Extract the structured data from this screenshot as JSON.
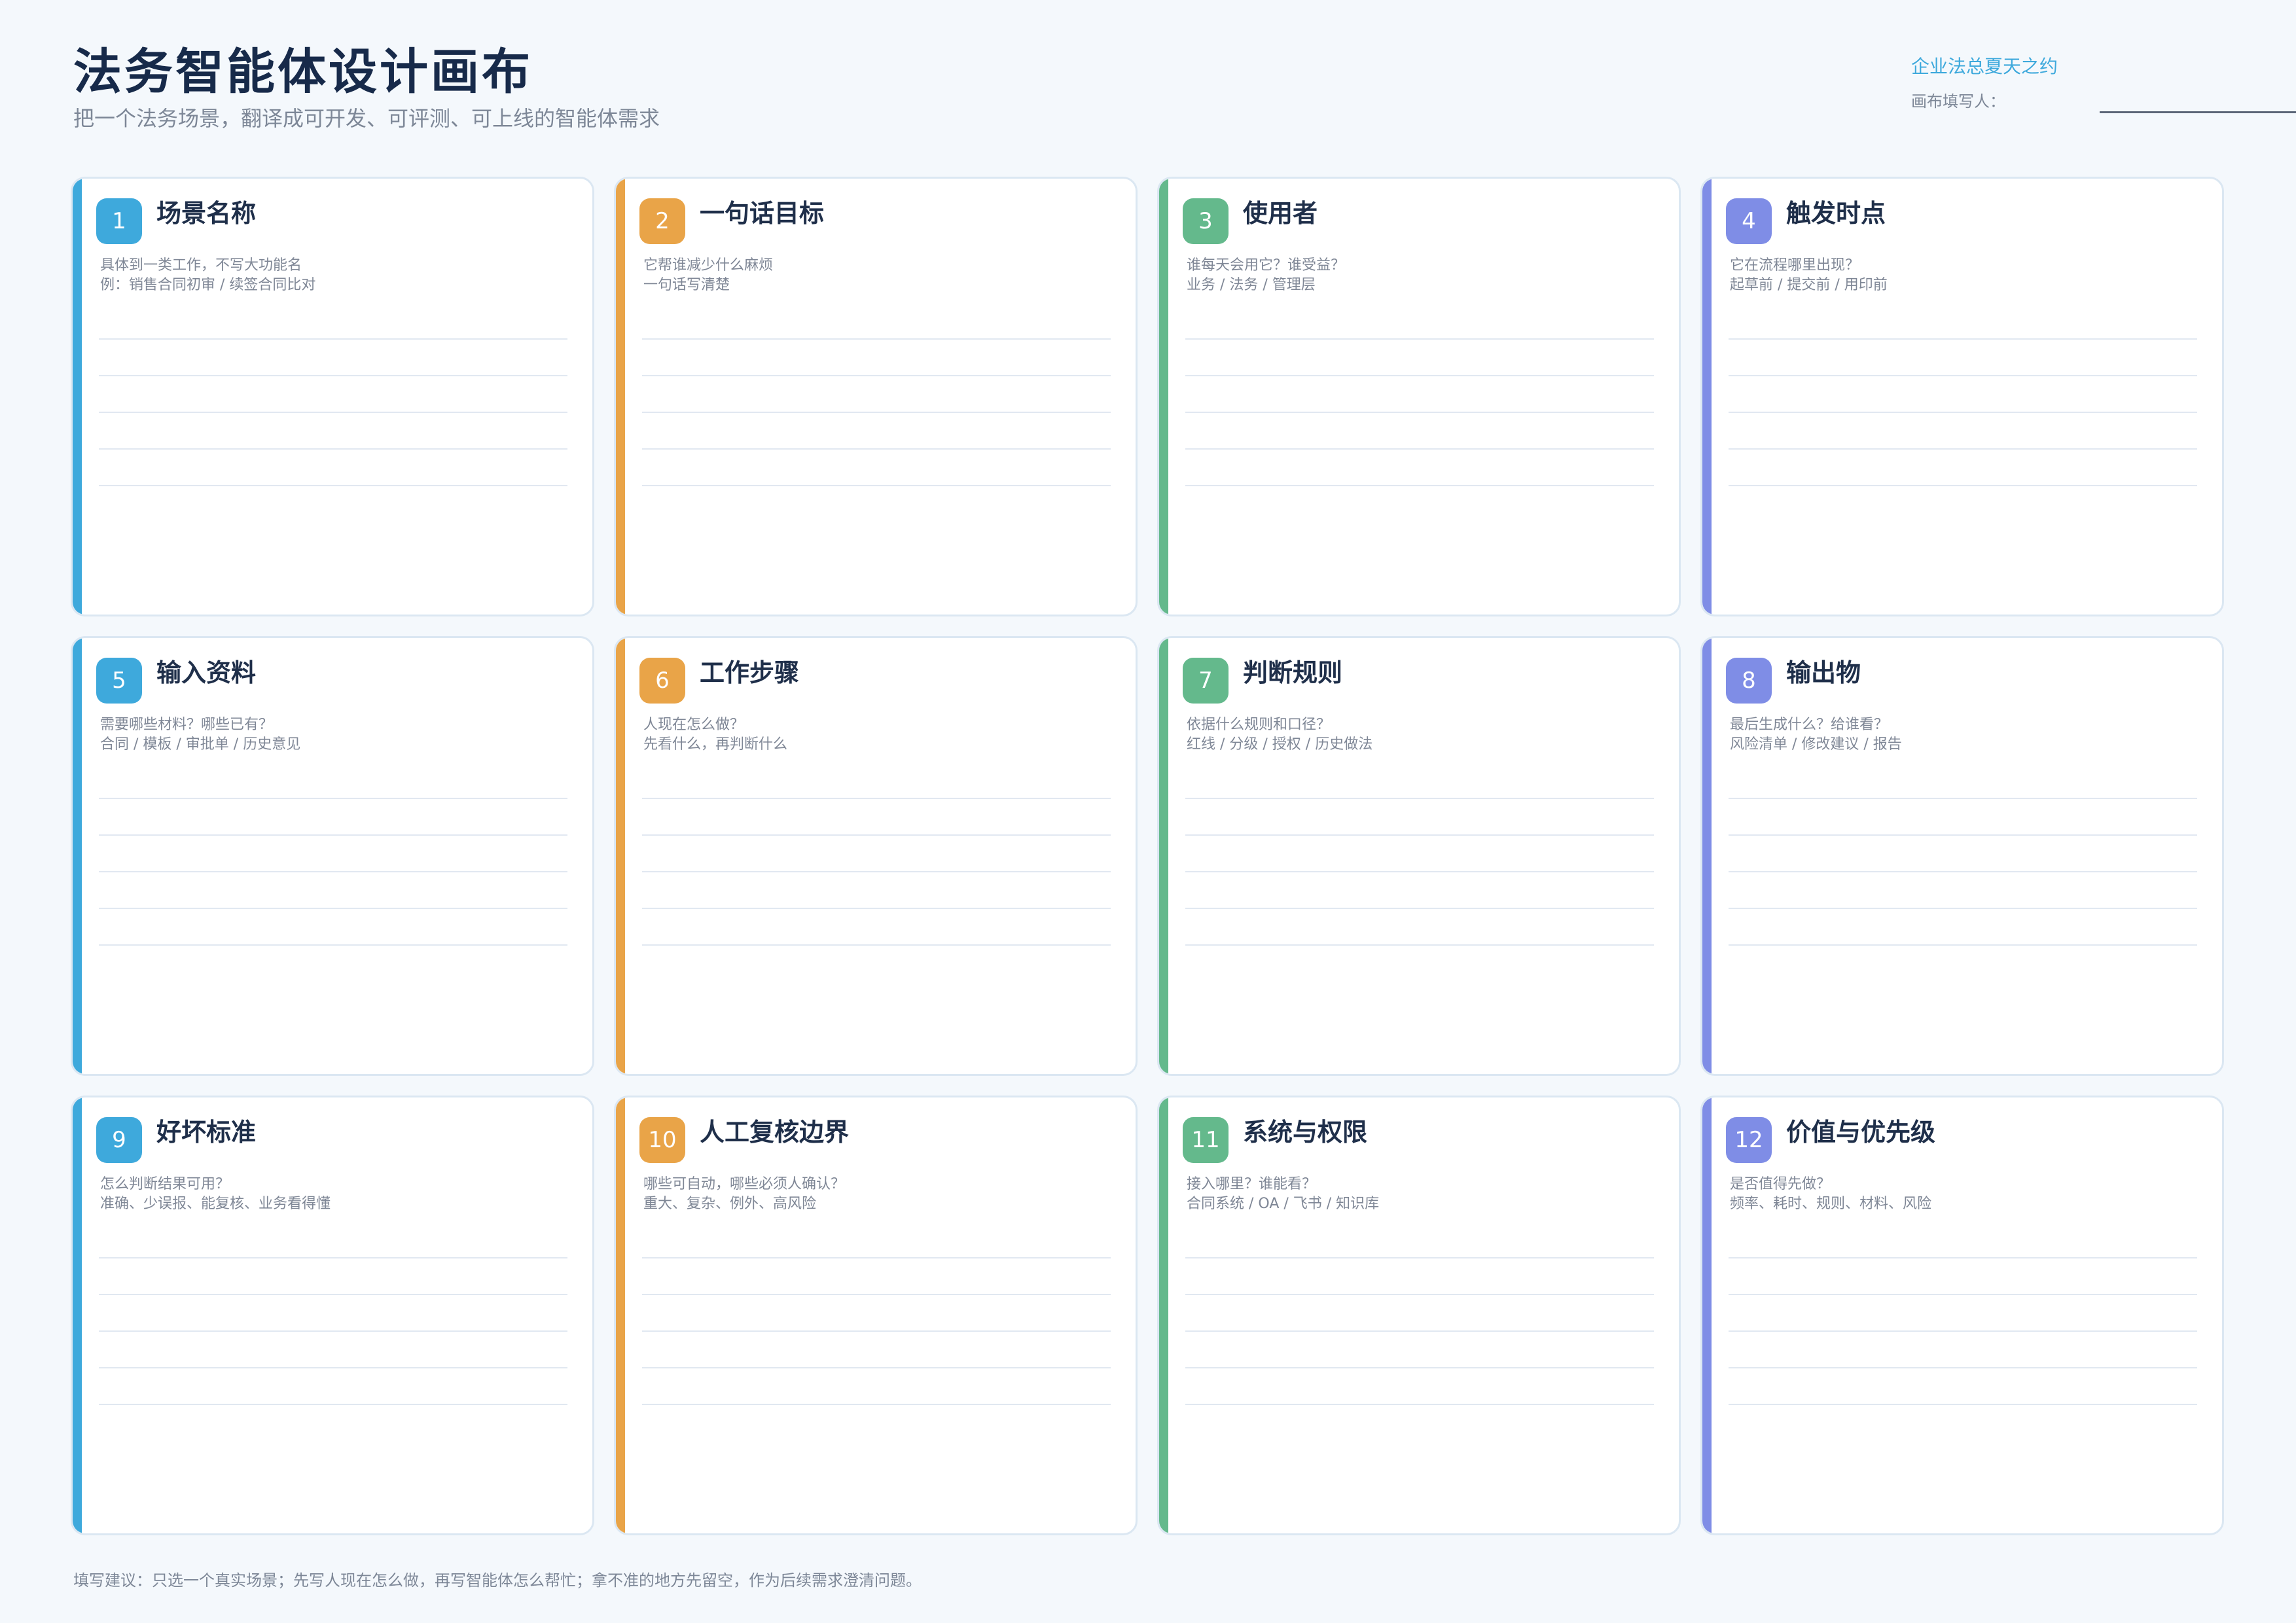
{
  "header": {
    "title": "法务智能体设计画布",
    "subtitle": "把一个法务场景，翻译成可开发、可评测、可上线的智能体需求",
    "brand": "企业法总夏天之约",
    "filler_label": "画布填写人："
  },
  "colors": {
    "blue": "#3ea9dc",
    "orange": "#e9a448",
    "green": "#64b98c",
    "purple": "#7f8de6"
  },
  "cards": [
    {
      "num": "1",
      "title": "场景名称",
      "line1": "具体到一类工作，不写大功能名",
      "line2": "例：销售合同初审 / 续签合同比对",
      "color": "blue"
    },
    {
      "num": "2",
      "title": "一句话目标",
      "line1": "它帮谁减少什么麻烦",
      "line2": "一句话写清楚",
      "color": "orange"
    },
    {
      "num": "3",
      "title": "使用者",
      "line1": "谁每天会用它？谁受益？",
      "line2": "业务 / 法务 / 管理层",
      "color": "green"
    },
    {
      "num": "4",
      "title": "触发时点",
      "line1": "它在流程哪里出现？",
      "line2": "起草前 / 提交前 / 用印前",
      "color": "purple"
    },
    {
      "num": "5",
      "title": "输入资料",
      "line1": "需要哪些材料？哪些已有？",
      "line2": "合同 / 模板 / 审批单 / 历史意见",
      "color": "blue"
    },
    {
      "num": "6",
      "title": "工作步骤",
      "line1": "人现在怎么做？",
      "line2": "先看什么，再判断什么",
      "color": "orange"
    },
    {
      "num": "7",
      "title": "判断规则",
      "line1": "依据什么规则和口径？",
      "line2": "红线 / 分级 / 授权 / 历史做法",
      "color": "green"
    },
    {
      "num": "8",
      "title": "输出物",
      "line1": "最后生成什么？给谁看？",
      "line2": "风险清单 / 修改建议 / 报告",
      "color": "purple"
    },
    {
      "num": "9",
      "title": "好坏标准",
      "line1": "怎么判断结果可用？",
      "line2": "准确、少误报、能复核、业务看得懂",
      "color": "blue"
    },
    {
      "num": "10",
      "title": "人工复核边界",
      "line1": "哪些可自动，哪些必须人确认？",
      "line2": "重大、复杂、例外、高风险",
      "color": "orange"
    },
    {
      "num": "11",
      "title": "系统与权限",
      "line1": "接入哪里？谁能看？",
      "line2": "合同系统 / OA / 飞书 / 知识库",
      "color": "green"
    },
    {
      "num": "12",
      "title": "价值与优先级",
      "line1": "是否值得先做？",
      "line2": "频率、耗时、规则、材料、风险",
      "color": "purple"
    }
  ],
  "footer": {
    "text": "填写建议：只选一个真实场景；先写人现在怎么做，再写智能体怎么帮忙；拿不准的地方先留空，作为后续需求澄清问题。"
  }
}
